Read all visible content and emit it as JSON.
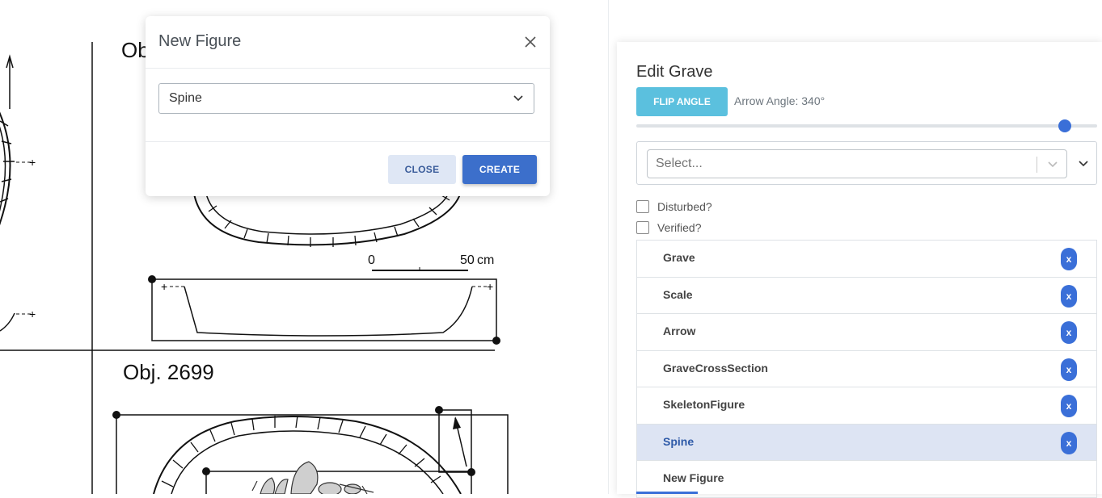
{
  "canvas": {
    "labels": [
      "Ob",
      "Obj. 2699"
    ],
    "scale": {
      "start": "0",
      "end": "50",
      "unit": "cm"
    },
    "pointer_text": "+"
  },
  "modal": {
    "title": "New Figure",
    "select_value": "Spine",
    "close_label": "CLOSE",
    "create_label": "CREATE"
  },
  "panel": {
    "title": "Edit Grave",
    "flip_label": "FLIP ANGLE",
    "angle_label": "Arrow Angle: 340°",
    "angle_value": 340,
    "select_placeholder": "Select...",
    "disturbed_label": "Disturbed?",
    "verified_label": "Verified?",
    "items": [
      {
        "label": "Grave",
        "delete": "x"
      },
      {
        "label": "Scale",
        "delete": "x"
      },
      {
        "label": "Arrow",
        "delete": "x"
      },
      {
        "label": "GraveCrossSection",
        "delete": "x"
      },
      {
        "label": "SkeletonFigure",
        "delete": "x"
      },
      {
        "label": "Spine",
        "delete": "x"
      },
      {
        "label": "New Figure"
      }
    ]
  },
  "colors": {
    "primary": "#3c6fcb",
    "flip_button": "#5bc0de",
    "active_item": "#dde4f3"
  }
}
